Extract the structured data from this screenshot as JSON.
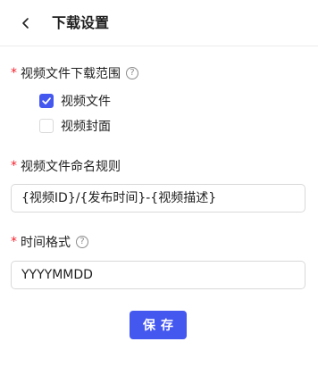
{
  "header": {
    "back_icon": "chevron-left-icon",
    "title": "下载设置"
  },
  "download_range": {
    "required_mark": "*",
    "label": "视频文件下载范围",
    "help_icon": "question-circle-icon",
    "help_glyph": "?",
    "options": [
      {
        "label": "视频文件",
        "checked": true
      },
      {
        "label": "视频封面",
        "checked": false
      }
    ]
  },
  "naming_rule": {
    "required_mark": "*",
    "label": "视频文件命名规则",
    "value": "{视频ID}/{发布时间}-{视频描述}"
  },
  "time_format": {
    "required_mark": "*",
    "label": "时间格式",
    "help_icon": "question-circle-icon",
    "help_glyph": "?",
    "value": "YYYYMMDD"
  },
  "actions": {
    "save_label": "保存"
  },
  "colors": {
    "primary": "#4458f0",
    "required": "#f5222d",
    "border": "#d9d9d9"
  }
}
